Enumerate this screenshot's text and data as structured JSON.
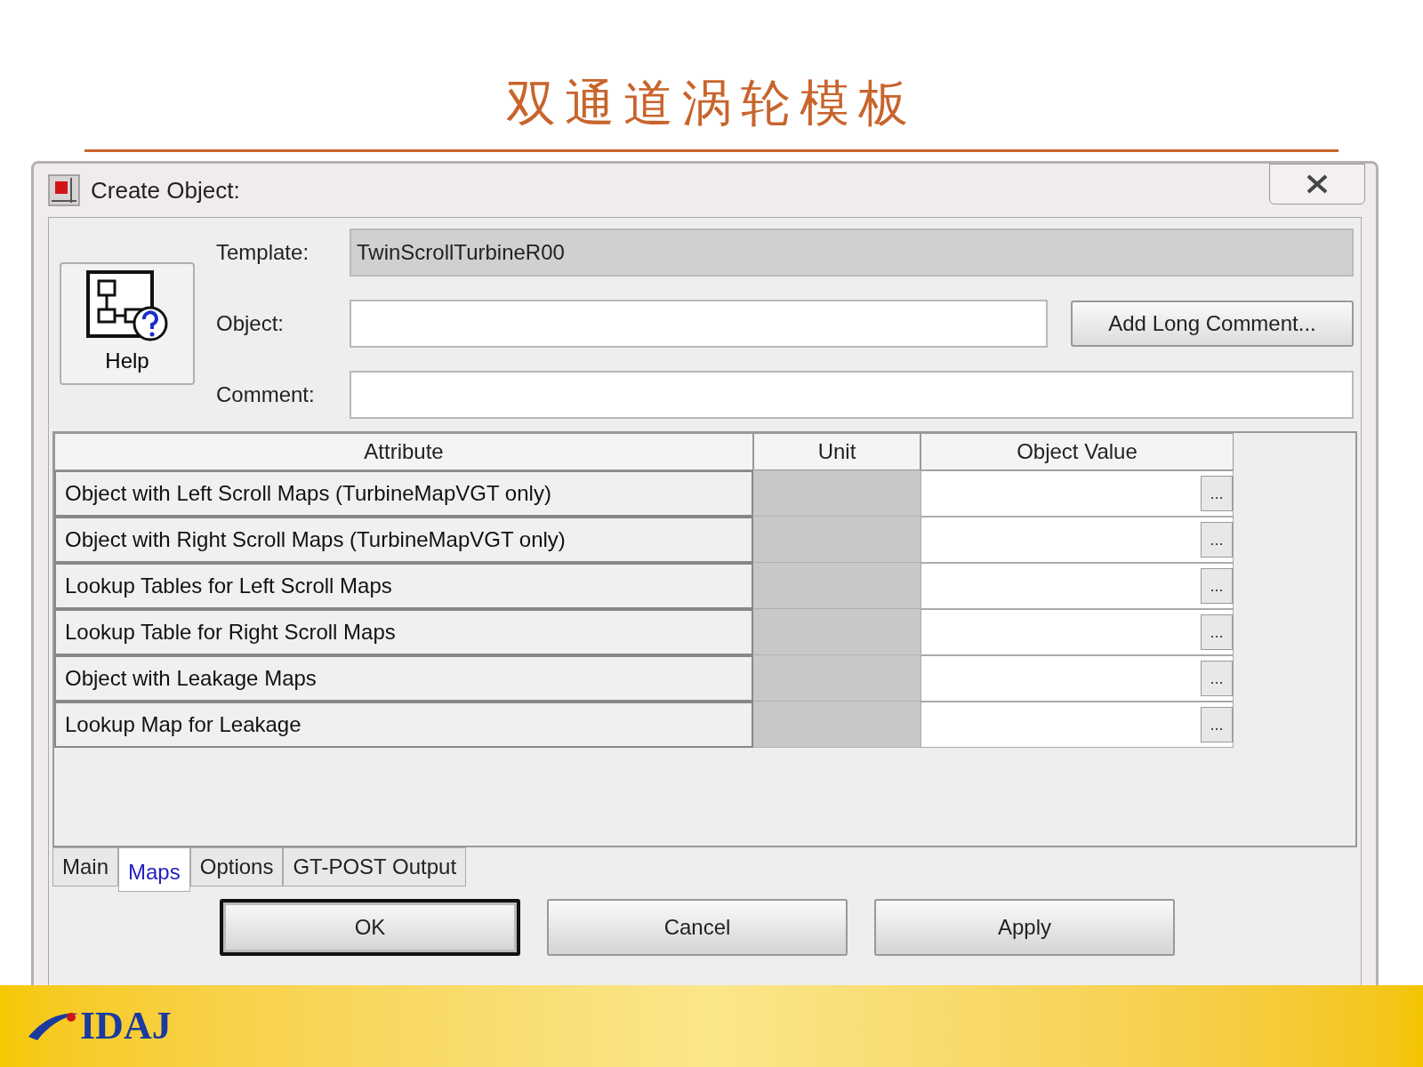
{
  "slide": {
    "title": "双通道涡轮模板",
    "logo": "IDAJ"
  },
  "window": {
    "title": "Create Object:"
  },
  "help_button": "Help",
  "fields": [
    {
      "label": "Template:",
      "value": "TwinScrollTurbineR00",
      "disabled": true
    },
    {
      "label": "Object:",
      "disabled": false,
      "button": "Add Long Comment..."
    },
    {
      "label": "Comment:",
      "disabled": false
    }
  ],
  "table": {
    "columns": [
      "Attribute",
      "Unit",
      "Object Value"
    ],
    "rows": [
      {
        "attribute": "Object with Left Scroll Maps (TurbineMapVGT only)",
        "browse": "..."
      },
      {
        "attribute": "Object with Right Scroll Maps (TurbineMapVGT only)",
        "browse": "..."
      },
      {
        "attribute": "Lookup Tables for Left Scroll Maps",
        "browse": "..."
      },
      {
        "attribute": "Lookup Table for Right Scroll Maps",
        "browse": "..."
      },
      {
        "attribute": "Object with Leakage Maps",
        "browse": "..."
      },
      {
        "attribute": "Lookup Map for Leakage",
        "browse": "..."
      }
    ]
  },
  "tabs": [
    {
      "label": "Main",
      "selected": false
    },
    {
      "label": "Maps",
      "selected": true
    },
    {
      "label": "Options",
      "selected": false
    },
    {
      "label": "GT-POST Output",
      "selected": false
    }
  ],
  "buttons": [
    {
      "label": "OK",
      "default": true
    },
    {
      "label": "Cancel",
      "default": false
    },
    {
      "label": "Apply",
      "default": false
    }
  ]
}
